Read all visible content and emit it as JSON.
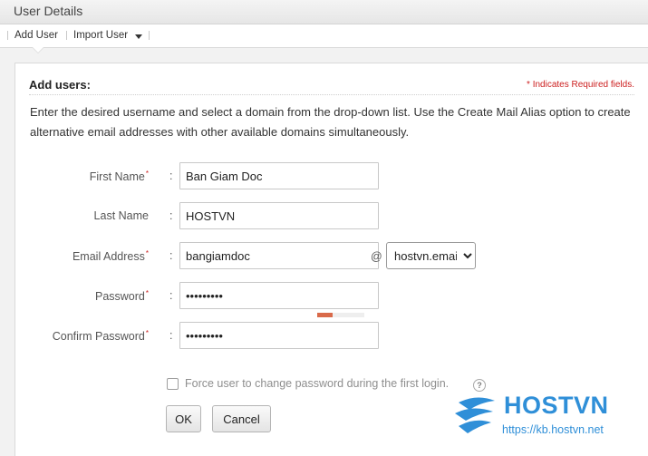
{
  "window": {
    "title": "User Details"
  },
  "toolbar": {
    "add_user": "Add User",
    "import_user": "Import User"
  },
  "form": {
    "heading": "Add users:",
    "required_note": "* Indicates Required fields.",
    "description": "Enter the desired username and select a domain from the drop-down list. Use the Create Mail Alias option to create alternative email addresses with other available domains simultaneously.",
    "first_name": {
      "label": "First Name",
      "value": "Ban Giam Doc",
      "required": true
    },
    "last_name": {
      "label": "Last Name",
      "value": "HOSTVN",
      "required": false
    },
    "email": {
      "label": "Email Address",
      "value": "bangiamdoc",
      "at": "@",
      "domain": "hostvn.email",
      "required": true
    },
    "password": {
      "label": "Password",
      "value": "•••••••••",
      "required": true,
      "strength_fraction": 0.33
    },
    "confirm_password": {
      "label": "Confirm Password",
      "value": "•••••••••",
      "required": true
    },
    "force_change": {
      "label": "Force user to change password during the first login.",
      "checked": false
    },
    "help_glyph": "?",
    "ok_label": "OK",
    "cancel_label": "Cancel",
    "asterisk": "*",
    "colon": ":"
  },
  "watermark": {
    "brand": "HOSTVN",
    "url": "https://kb.hostvn.net"
  },
  "colors": {
    "required": "#cc1f1f",
    "brand": "#2f8fd8",
    "strength": "#d96a4a"
  }
}
